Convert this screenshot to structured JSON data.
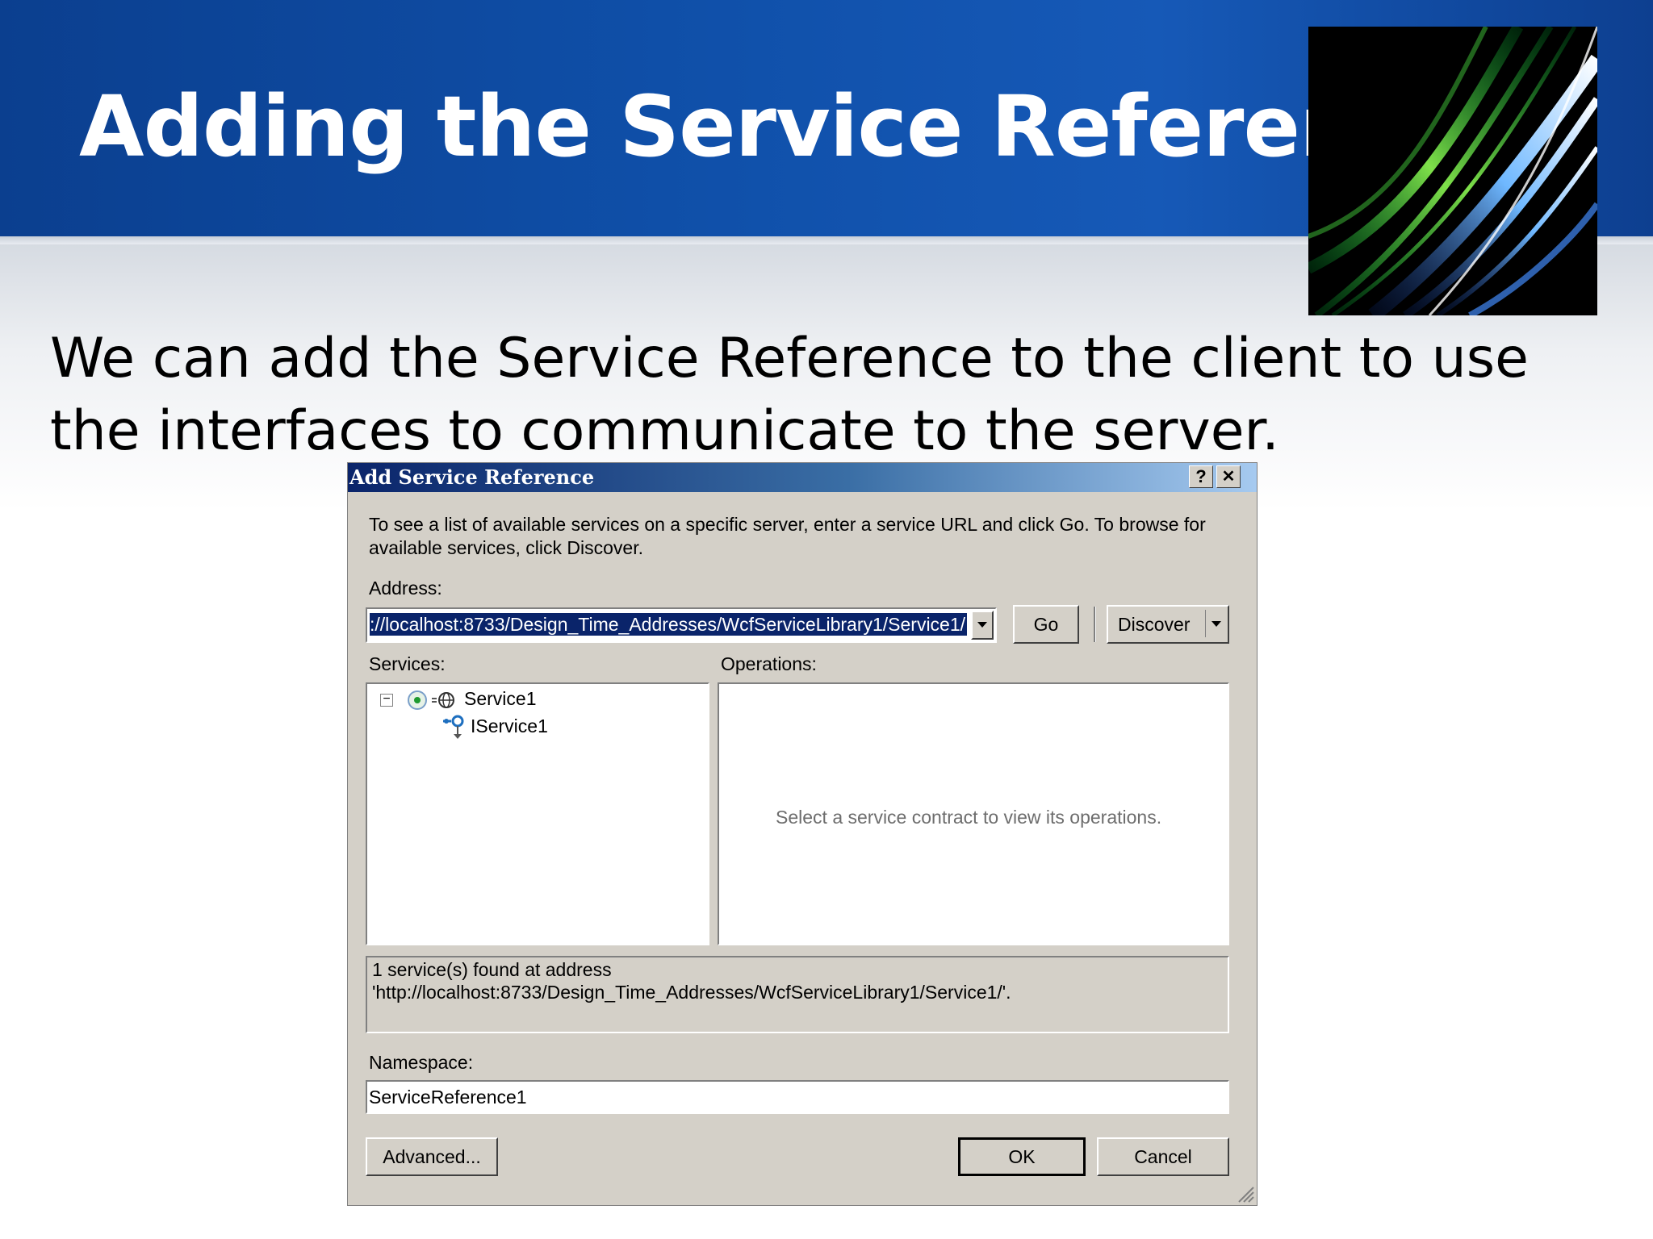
{
  "slide": {
    "title": "Adding the Service Reference",
    "body": "We can add the Service Reference to the client to use the interfaces to communicate to the server."
  },
  "colors": {
    "header_blue": "#0f4fa8",
    "dialog_gray": "#d4d0c8",
    "titlebar_start": "#0a246a",
    "titlebar_end": "#a6caf0",
    "selection": "#0a246a"
  },
  "dialog": {
    "title": "Add Service Reference",
    "help_label": "?",
    "close_label": "✕",
    "instructions": "To see a list of available services on a specific server, enter a service URL and click Go. To browse for available services, click Discover.",
    "address_label": "Address:",
    "address_value": "://localhost:8733/Design_Time_Addresses/WcfServiceLibrary1/Service1/",
    "go_label": "Go",
    "discover_label": "Discover",
    "services_label": "Services:",
    "operations_label": "Operations:",
    "tree": {
      "expander": "−",
      "service": "Service1",
      "contract": "IService1"
    },
    "operations_placeholder": "Select a service contract to view its operations.",
    "status_line1": "1 service(s) found at address",
    "status_line2": "'http://localhost:8733/Design_Time_Addresses/WcfServiceLibrary1/Service1/'.",
    "namespace_label": "Namespace:",
    "namespace_value": "ServiceReference1",
    "advanced_label": "Advanced...",
    "ok_label": "OK",
    "cancel_label": "Cancel"
  }
}
